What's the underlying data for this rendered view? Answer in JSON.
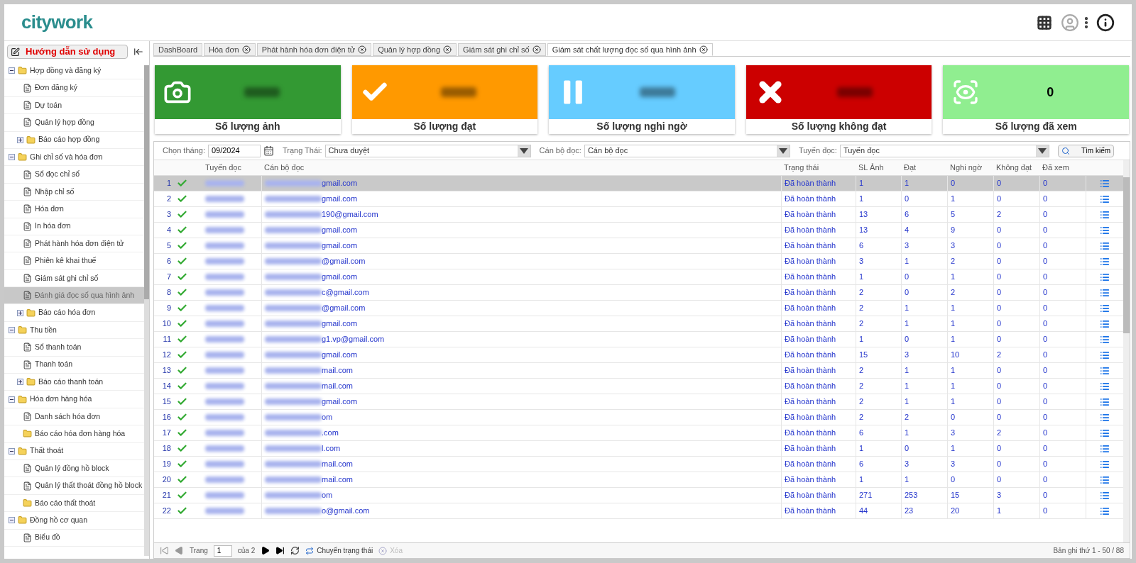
{
  "header": {
    "logo": "citywork"
  },
  "sidebar": {
    "guide_button": "Hướng dẫn sử dụng",
    "tree": [
      {
        "label": "Hợp đồng và đăng ký",
        "kind": "folder",
        "expanded": true,
        "selected": false,
        "children": [
          {
            "label": "Đơn đăng ký",
            "kind": "page",
            "selected": false
          },
          {
            "label": "Dự toán",
            "kind": "page",
            "selected": false
          },
          {
            "label": "Quản lý hợp đồng",
            "kind": "page",
            "selected": false
          },
          {
            "label": "Báo cáo hợp đồng",
            "kind": "folder",
            "expanded": false,
            "selected": false
          }
        ]
      },
      {
        "label": "Ghi chỉ số và hóa đơn",
        "kind": "folder",
        "expanded": true,
        "selected": false,
        "children": [
          {
            "label": "Sổ đọc chỉ số",
            "kind": "page",
            "selected": false
          },
          {
            "label": "Nhập chỉ số",
            "kind": "page",
            "selected": false
          },
          {
            "label": "Hóa đơn",
            "kind": "page",
            "selected": false
          },
          {
            "label": "In hóa đơn",
            "kind": "page",
            "selected": false
          },
          {
            "label": "Phát hành hóa đơn điện tử",
            "kind": "page",
            "selected": false
          },
          {
            "label": "Phiên kê khai thuế",
            "kind": "page",
            "selected": false
          },
          {
            "label": "Giám sát ghi chỉ số",
            "kind": "page",
            "selected": false
          },
          {
            "label": "Đánh giá đọc số qua hình ảnh",
            "kind": "page",
            "selected": true
          },
          {
            "label": "Báo cáo hóa đơn",
            "kind": "folder",
            "expanded": false,
            "selected": false
          }
        ]
      },
      {
        "label": "Thu tiền",
        "kind": "folder",
        "expanded": true,
        "selected": false,
        "children": [
          {
            "label": "Sổ thanh toán",
            "kind": "page",
            "selected": false
          },
          {
            "label": "Thanh toán",
            "kind": "page",
            "selected": false
          },
          {
            "label": "Báo cáo thanh toán",
            "kind": "folder",
            "expanded": false,
            "selected": false
          }
        ]
      },
      {
        "label": "Hóa đơn hàng hóa",
        "kind": "folder",
        "expanded": true,
        "selected": false,
        "children": [
          {
            "label": "Danh sách hóa đơn",
            "kind": "page",
            "selected": false
          },
          {
            "label": "Báo cáo hóa đơn hàng hóa",
            "kind": "leaf_folder",
            "selected": false
          }
        ]
      },
      {
        "label": "Thất thoát",
        "kind": "folder",
        "expanded": true,
        "selected": false,
        "children": [
          {
            "label": "Quản lý đồng hồ block",
            "kind": "page",
            "selected": false
          },
          {
            "label": "Quản lý thất thoát đồng hồ block",
            "kind": "page",
            "selected": false
          },
          {
            "label": "Báo cáo thất thoát",
            "kind": "leaf_folder",
            "selected": false
          }
        ]
      },
      {
        "label": "Đồng hồ cơ quan",
        "kind": "folder",
        "expanded": true,
        "selected": false,
        "children": [
          {
            "label": "Biểu đồ",
            "kind": "page",
            "selected": false
          }
        ]
      }
    ]
  },
  "tabs": [
    {
      "label": "DashBoard",
      "closable": false,
      "selected": false
    },
    {
      "label": "Hóa đơn",
      "closable": true,
      "selected": false
    },
    {
      "label": "Phát hành hóa đơn điện tử",
      "closable": true,
      "selected": false
    },
    {
      "label": "Quản lý hợp đồng",
      "closable": true,
      "selected": false
    },
    {
      "label": "Giám sát ghi chỉ số",
      "closable": true,
      "selected": false
    },
    {
      "label": "Giám sát chất lượng đọc số qua hình ảnh",
      "closable": true,
      "selected": true
    }
  ],
  "cards": [
    {
      "kind": "camera",
      "color": "#339933",
      "label": "Số lượng ảnh"
    },
    {
      "kind": "check",
      "color": "#ff9900",
      "label": "Số lượng đạt"
    },
    {
      "kind": "pause",
      "color": "#66ccff",
      "label": "Số lượng nghi ngờ"
    },
    {
      "kind": "cross",
      "color": "#cc0000",
      "label": "Số lượng không đạt"
    },
    {
      "kind": "eye",
      "color": "#90ee90",
      "label": "Số lượng đã xem",
      "value": "0"
    }
  ],
  "filters": {
    "month": {
      "label": "Chọn tháng:",
      "value": "09/2024"
    },
    "status": {
      "label": "Trạng Thái:",
      "value": "Chưa duyệt"
    },
    "reader": {
      "label": "Cán bộ đọc:",
      "value": "Cán bộ đọc"
    },
    "route": {
      "label": "Tuyến đọc:",
      "value": "Tuyến đọc"
    },
    "search_button": "Tìm kiếm"
  },
  "table": {
    "columns": [
      "Tuyến đọc",
      "Cán bộ đọc",
      "Trạng thái",
      "SL Ảnh",
      "Đạt",
      "Nghi ngờ",
      "Không đạt",
      "Đã xem"
    ],
    "rows": [
      {
        "index": "1",
        "selected": true,
        "cells": [
          "",
          "gmail.com",
          "Đã hoàn thành",
          "1",
          "1",
          "0",
          "0",
          "0"
        ]
      },
      {
        "index": "2",
        "selected": false,
        "cells": [
          "",
          "gmail.com",
          "Đã hoàn thành",
          "1",
          "0",
          "1",
          "0",
          "0"
        ]
      },
      {
        "index": "3",
        "selected": false,
        "cells": [
          "",
          "190@gmail.com",
          "Đã hoàn thành",
          "13",
          "6",
          "5",
          "2",
          "0"
        ]
      },
      {
        "index": "4",
        "selected": false,
        "cells": [
          "",
          "gmail.com",
          "Đã hoàn thành",
          "13",
          "4",
          "9",
          "0",
          "0"
        ]
      },
      {
        "index": "5",
        "selected": false,
        "cells": [
          "",
          "gmail.com",
          "Đã hoàn thành",
          "6",
          "3",
          "3",
          "0",
          "0"
        ]
      },
      {
        "index": "6",
        "selected": false,
        "cells": [
          "",
          "@gmail.com",
          "Đã hoàn thành",
          "3",
          "1",
          "2",
          "0",
          "0"
        ]
      },
      {
        "index": "7",
        "selected": false,
        "cells": [
          "",
          "gmail.com",
          "Đã hoàn thành",
          "1",
          "0",
          "1",
          "0",
          "0"
        ]
      },
      {
        "index": "8",
        "selected": false,
        "cells": [
          "",
          "c@gmail.com",
          "Đã hoàn thành",
          "2",
          "0",
          "2",
          "0",
          "0"
        ]
      },
      {
        "index": "9",
        "selected": false,
        "cells": [
          "",
          "@gmail.com",
          "Đã hoàn thành",
          "2",
          "1",
          "1",
          "0",
          "0"
        ]
      },
      {
        "index": "10",
        "selected": false,
        "cells": [
          "",
          "gmail.com",
          "Đã hoàn thành",
          "2",
          "1",
          "1",
          "0",
          "0"
        ]
      },
      {
        "index": "11",
        "selected": false,
        "cells": [
          "",
          "g1.vp@gmail.com",
          "Đã hoàn thành",
          "1",
          "0",
          "1",
          "0",
          "0"
        ]
      },
      {
        "index": "12",
        "selected": false,
        "cells": [
          "",
          "gmail.com",
          "Đã hoàn thành",
          "15",
          "3",
          "10",
          "2",
          "0"
        ]
      },
      {
        "index": "13",
        "selected": false,
        "cells": [
          "",
          "mail.com",
          "Đã hoàn thành",
          "2",
          "1",
          "1",
          "0",
          "0"
        ]
      },
      {
        "index": "14",
        "selected": false,
        "cells": [
          "",
          "mail.com",
          "Đã hoàn thành",
          "2",
          "1",
          "1",
          "0",
          "0"
        ]
      },
      {
        "index": "15",
        "selected": false,
        "cells": [
          "",
          "gmail.com",
          "Đã hoàn thành",
          "2",
          "1",
          "1",
          "0",
          "0"
        ]
      },
      {
        "index": "16",
        "selected": false,
        "cells": [
          "",
          "om",
          "Đã hoàn thành",
          "2",
          "2",
          "0",
          "0",
          "0"
        ]
      },
      {
        "index": "17",
        "selected": false,
        "cells": [
          "",
          ".com",
          "Đã hoàn thành",
          "6",
          "1",
          "3",
          "2",
          "0"
        ]
      },
      {
        "index": "18",
        "selected": false,
        "cells": [
          "",
          "l.com",
          "Đã hoàn thành",
          "1",
          "0",
          "1",
          "0",
          "0"
        ]
      },
      {
        "index": "19",
        "selected": false,
        "cells": [
          "",
          "mail.com",
          "Đã hoàn thành",
          "6",
          "3",
          "3",
          "0",
          "0"
        ]
      },
      {
        "index": "20",
        "selected": false,
        "cells": [
          "",
          "mail.com",
          "Đã hoàn thành",
          "1",
          "1",
          "0",
          "0",
          "0"
        ]
      },
      {
        "index": "21",
        "selected": false,
        "cells": [
          "",
          "om",
          "Đã hoàn thành",
          "271",
          "253",
          "15",
          "3",
          "0"
        ]
      },
      {
        "index": "22",
        "selected": false,
        "cells": [
          "",
          "o@gmail.com",
          "Đã hoàn thành",
          "44",
          "23",
          "20",
          "1",
          "0"
        ]
      }
    ]
  },
  "pager": {
    "page_label": "Trang",
    "page": "1",
    "of": "của 2",
    "change_status": "Chuyển trạng thái",
    "delete": "Xóa",
    "delete_disabled": true,
    "records": "Bản ghi thứ 1 - 50 / 88"
  }
}
